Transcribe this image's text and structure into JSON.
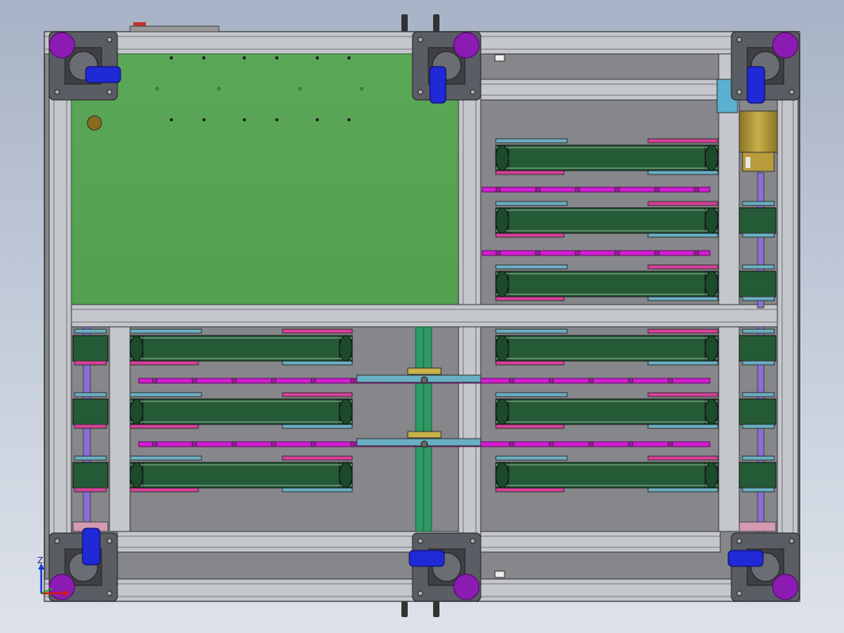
{
  "viewport": {
    "title": "",
    "background_top": "#a7b2c6",
    "background_bottom": "#dde2ea"
  },
  "triad": {
    "z_label": "Z",
    "x_color": "#d11a1a",
    "y_color": "#1aa11a",
    "z_color": "#1a3ad1"
  },
  "colors": {
    "frame": "#c4c7cc",
    "frame_edge": "#3a3a3a",
    "floor": "#858587",
    "pcb": "#57a455",
    "belt": "#245a36",
    "shaft": "#d21ed2",
    "caster_plate": "#5a5d63",
    "caster_wheel": "#1f2ad6",
    "foot_pad": "#8c1bb3",
    "bracket": "#6ab0c4",
    "motor": "#b29a38",
    "center_shaft": "#2e9a63",
    "guide_rod": "#8a6fd6"
  }
}
